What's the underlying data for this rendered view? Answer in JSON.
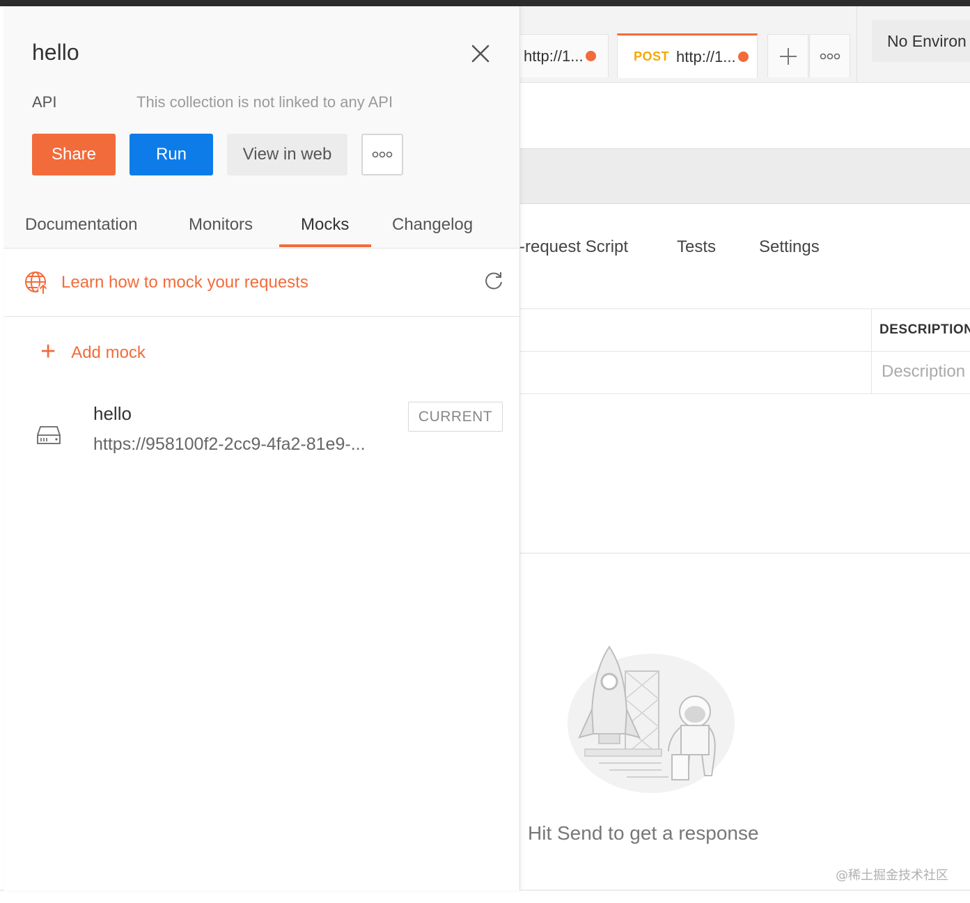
{
  "collection": {
    "title": "hello",
    "api_label": "API",
    "api_note": "This collection is not linked to any API"
  },
  "actions": {
    "share": "Share",
    "run": "Run",
    "view_in_web": "View in web"
  },
  "tabs": [
    {
      "label": "Documentation"
    },
    {
      "label": "Monitors"
    },
    {
      "label": "Mocks"
    },
    {
      "label": "Changelog"
    }
  ],
  "active_tab": "Mocks",
  "mocks_panel": {
    "learn_link": "Learn how to mock your requests",
    "add_mock": "Add mock",
    "items": [
      {
        "name": "hello",
        "url": "https://958100f2-2cc9-4fa2-81e9-...",
        "badge": "CURRENT"
      }
    ]
  },
  "background": {
    "request_tabs": [
      {
        "method": "",
        "url": "http://1..."
      },
      {
        "method": "POST",
        "url": "http://1..."
      }
    ],
    "environment": "No Environ",
    "request_subtabs": [
      "-request Script",
      "Tests",
      "Settings"
    ],
    "params_column": "DESCRIPTION",
    "description_placeholder": "Description",
    "response_empty": "Hit Send to get a response",
    "watermark": "@稀土掘金技术社区"
  },
  "colors": {
    "accent": "#f26b3a",
    "primary": "#0d7ce8",
    "method_post": "#f4a900"
  }
}
